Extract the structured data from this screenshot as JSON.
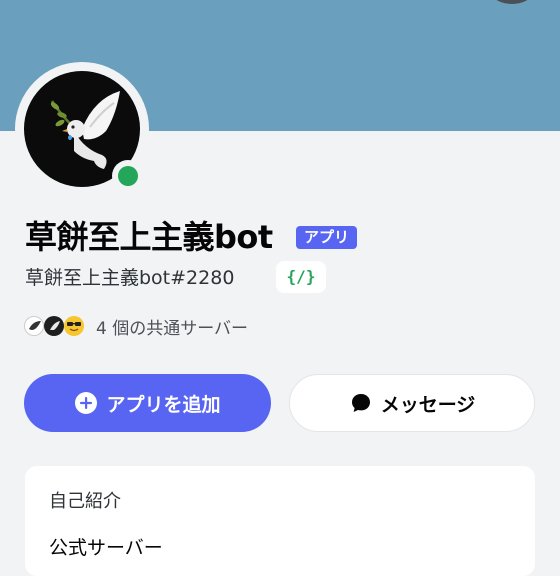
{
  "profile": {
    "name": "草餅至上主義bot",
    "app_badge": "アプリ",
    "username": "草餅至上主義bot#2280",
    "command_badge": "{/}",
    "status": "online",
    "avatar_icon": "dove-icon"
  },
  "mutual": {
    "text": "4 個の共通サーバー",
    "icons": [
      "dove-server-icon",
      "dark-server-icon",
      "sunglasses-emoji-icon"
    ]
  },
  "buttons": {
    "add_app": "アプリを追加",
    "message": "メッセージ"
  },
  "about": {
    "title": "自己紹介",
    "body": "公式サーバー"
  },
  "colors": {
    "banner": "#6aa0bd",
    "primary": "#5865f2",
    "online": "#23a55a"
  }
}
